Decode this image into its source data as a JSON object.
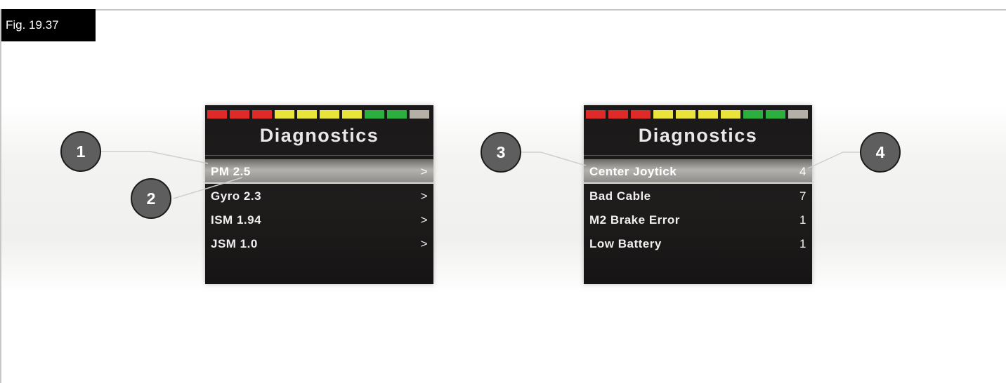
{
  "figure_label": "Fig. 19.37",
  "battery_colors": [
    "#e02a2a",
    "#e02a2a",
    "#e02a2a",
    "#e9e43a",
    "#e9e43a",
    "#e9e43a",
    "#e9e43a",
    "#2bb03f",
    "#2bb03f",
    "#b4b0a8"
  ],
  "panels": [
    {
      "title": "Diagnostics",
      "rows": [
        {
          "label": "PM 2.5",
          "value": ">"
        },
        {
          "label": "Gyro 2.3",
          "value": ">"
        },
        {
          "label": "ISM 1.94",
          "value": ">"
        },
        {
          "label": "JSM 1.0",
          "value": ">"
        }
      ]
    },
    {
      "title": "Diagnostics",
      "rows": [
        {
          "label": "Center Joytick",
          "value": "4"
        },
        {
          "label": "Bad Cable",
          "value": "7"
        },
        {
          "label": "M2 Brake Error",
          "value": "1"
        },
        {
          "label": "Low Battery",
          "value": "1"
        }
      ]
    }
  ],
  "callouts": [
    "1",
    "2",
    "3",
    "4"
  ]
}
